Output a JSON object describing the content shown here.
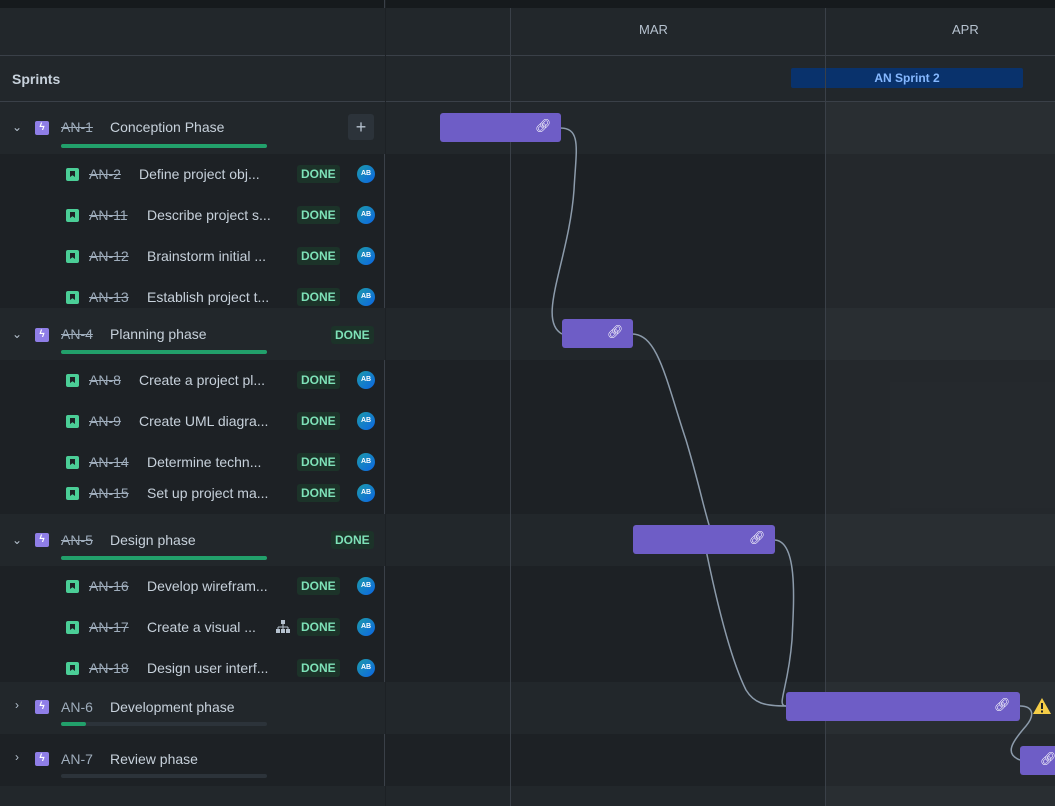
{
  "sprints_label": "Sprints",
  "months": [
    "MAR",
    "APR"
  ],
  "sprint": {
    "name": "AN Sprint 2"
  },
  "epics": [
    {
      "key": "AN-1",
      "title": "Conception Phase",
      "status": "",
      "progress": 1.0,
      "expanded": true,
      "children": [
        {
          "key": "AN-2",
          "title": "Define project obj...",
          "status": "DONE",
          "assignee": "AB"
        },
        {
          "key": "AN-11",
          "title": "Describe project s...",
          "status": "DONE",
          "assignee": "AB"
        },
        {
          "key": "AN-12",
          "title": "Brainstorm initial ...",
          "status": "DONE",
          "assignee": "AB"
        },
        {
          "key": "AN-13",
          "title": "Establish project t...",
          "status": "DONE",
          "assignee": "AB"
        }
      ]
    },
    {
      "key": "AN-4",
      "title": "Planning phase",
      "status": "DONE",
      "progress": 1.0,
      "expanded": true,
      "children": [
        {
          "key": "AN-8",
          "title": "Create a project pl...",
          "status": "DONE",
          "assignee": "AB"
        },
        {
          "key": "AN-9",
          "title": "Create UML diagra...",
          "status": "DONE",
          "assignee": "AB"
        },
        {
          "key": "AN-14",
          "title": "Determine techn...",
          "status": "DONE",
          "assignee": "AB"
        },
        {
          "key": "AN-15",
          "title": "Set up project ma...",
          "status": "DONE",
          "assignee": "AB"
        }
      ]
    },
    {
      "key": "AN-5",
      "title": "Design phase",
      "status": "DONE",
      "progress": 1.0,
      "expanded": true,
      "children": [
        {
          "key": "AN-16",
          "title": "Develop wirefram...",
          "status": "DONE",
          "assignee": "AB"
        },
        {
          "key": "AN-17",
          "title": "Create a visual ...",
          "status": "DONE",
          "assignee": "AB",
          "child_icon": "hierarchy-icon"
        },
        {
          "key": "AN-18",
          "title": "Design user interf...",
          "status": "DONE",
          "assignee": "AB"
        }
      ]
    },
    {
      "key": "AN-6",
      "title": "Development phase",
      "status": "",
      "progress": 0.12,
      "expanded": false,
      "children": []
    },
    {
      "key": "AN-7",
      "title": "Review phase",
      "status": "",
      "progress": 0.0,
      "expanded": false,
      "children": []
    }
  ],
  "colors": {
    "bar": "#6e5dc6",
    "epic_icon": "#8f7ee7",
    "story_icon": "#4bce97",
    "done_badge_bg": "#1c3329",
    "done_badge_text": "#7ee2b8",
    "progress": "#22a06b",
    "sprint": "#09326c",
    "warning": "#f5cd47"
  },
  "icons": {
    "expand": "chevron-down-icon",
    "collapse": "chevron-right-icon",
    "epic": "epic-lightning-icon",
    "story": "story-bookmark-icon",
    "add": "plus-icon",
    "link": "link-icon",
    "warning": "warning-icon"
  }
}
